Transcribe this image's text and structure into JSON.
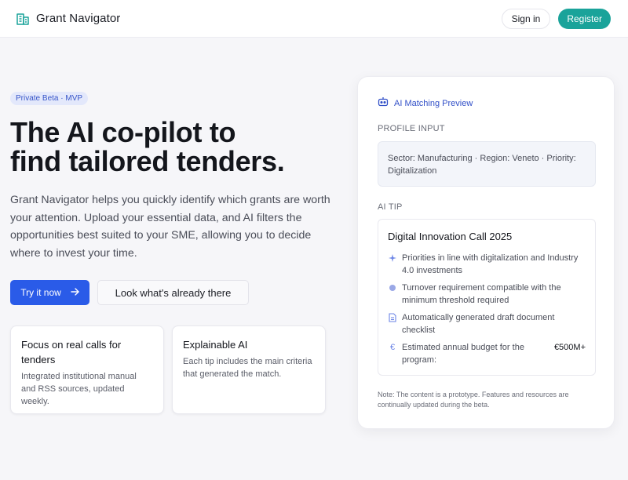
{
  "header": {
    "brand": "Grant Navigator",
    "signin_label": "Sign in",
    "register_label": "Register"
  },
  "hero": {
    "badge": "Private Beta · MVP",
    "title_line1": "The AI co-pilot to",
    "title_line2": "find tailored tenders.",
    "description": "Grant Navigator helps you quickly identify which grants are worth your attention. Upload your essential data, and AI filters the opportunities best suited to your SME, allowing you to decide where to invest your time.",
    "try_label": "Try it now",
    "look_label": "Look what's already there"
  },
  "features": [
    {
      "title": "Focus on real calls for tenders",
      "text": "Integrated institutional manual and RSS sources, updated weekly."
    },
    {
      "title": "Explainable AI",
      "text": "Each tip includes the main criteria that generated the match."
    }
  ],
  "panel": {
    "title": "AI Matching Preview",
    "profile_label": "PROFILE INPUT",
    "profile_text": "Sector: Manufacturing · Region: Veneto · Priority: Digitalization",
    "tip_label": "AI TIP",
    "tip_title": "Digital Innovation Call 2025",
    "tips": [
      {
        "icon": "sparkle-icon",
        "text": "Priorities in line with digitalization and Industry 4.0 investments"
      },
      {
        "icon": "dot-icon",
        "text": "Turnover requirement compatible with the minimum threshold required"
      },
      {
        "icon": "document-icon",
        "text": "Automatically generated draft document checklist"
      }
    ],
    "budget_text": "Estimated annual budget for the program:",
    "budget_value": "€500M+",
    "note": "Note: The content is a prototype. Features and resources are continually updated during the beta."
  },
  "colors": {
    "accent_teal": "#1aa39a",
    "primary_blue": "#2a5be8",
    "link_blue": "#3250c8"
  }
}
